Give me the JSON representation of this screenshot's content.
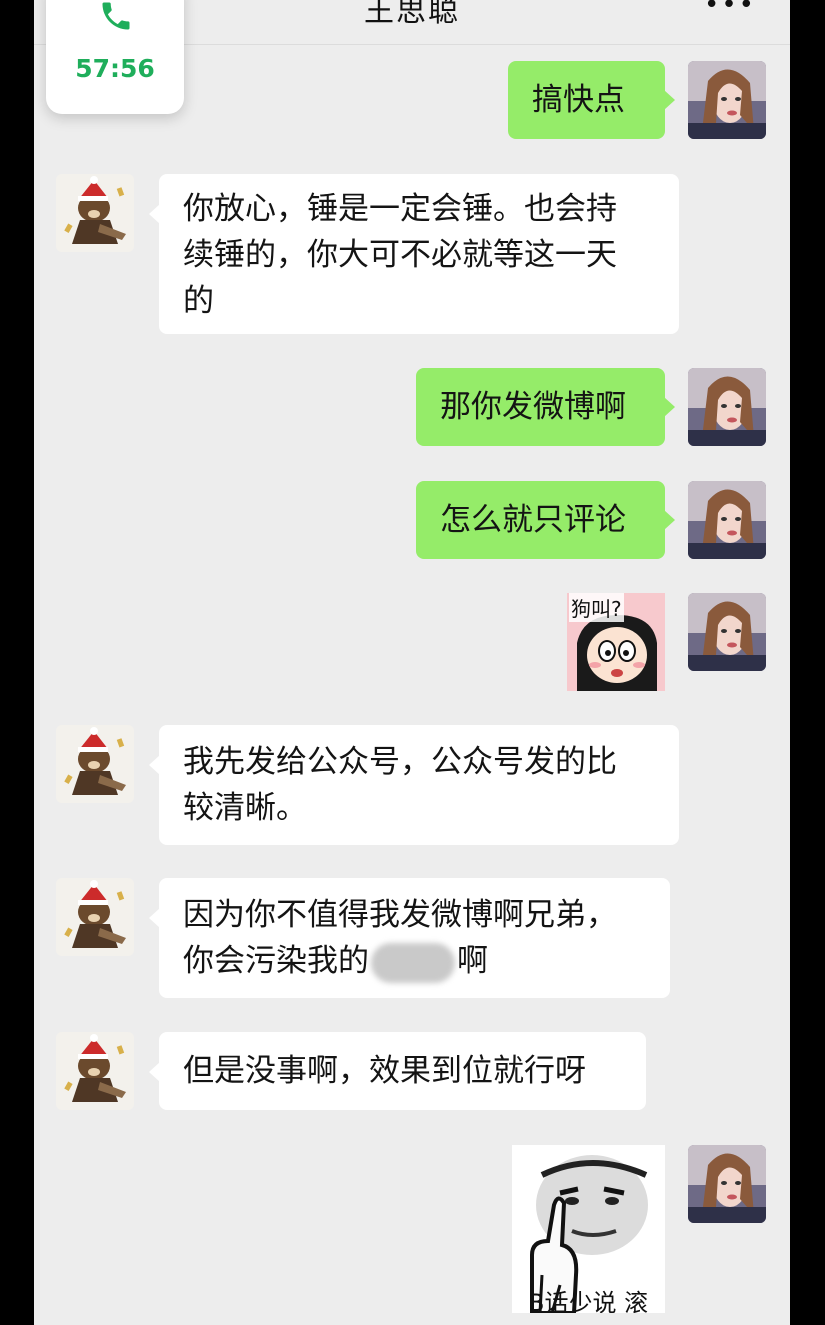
{
  "header": {
    "title": "王思聪",
    "more_icon": "more-dots-icon"
  },
  "call": {
    "icon": "phone-icon",
    "duration": "57:56"
  },
  "colors": {
    "outgoing_bubble": "#95ec69",
    "incoming_bubble": "#ffffff",
    "call_green": "#1fae5b",
    "background": "#ededed"
  },
  "messages": [
    {
      "sender": "self",
      "type": "text",
      "lines": [
        "搞快点"
      ]
    },
    {
      "sender": "other",
      "type": "text",
      "lines": [
        "你放心，锤是一定会锤。也会持",
        "续锤的，你大可不必就等这一天",
        "的"
      ]
    },
    {
      "sender": "self",
      "type": "text",
      "lines": [
        "那你发微博啊"
      ]
    },
    {
      "sender": "self",
      "type": "text",
      "lines": [
        "怎么就只评论"
      ]
    },
    {
      "sender": "self",
      "type": "sticker",
      "caption": "狗叫?"
    },
    {
      "sender": "other",
      "type": "text",
      "lines": [
        "我先发给公众号，公众号发的比",
        "较清晰。"
      ]
    },
    {
      "sender": "other",
      "type": "text",
      "lines": [
        "因为你不值得我发微博啊兄弟，",
        "你会污染我的"
      ],
      "line2_suffix": "啊"
    },
    {
      "sender": "other",
      "type": "text",
      "lines": [
        "但是没事啊，效果到位就行呀"
      ]
    },
    {
      "sender": "self",
      "type": "sticker",
      "caption": "B话少说 滚"
    }
  ]
}
